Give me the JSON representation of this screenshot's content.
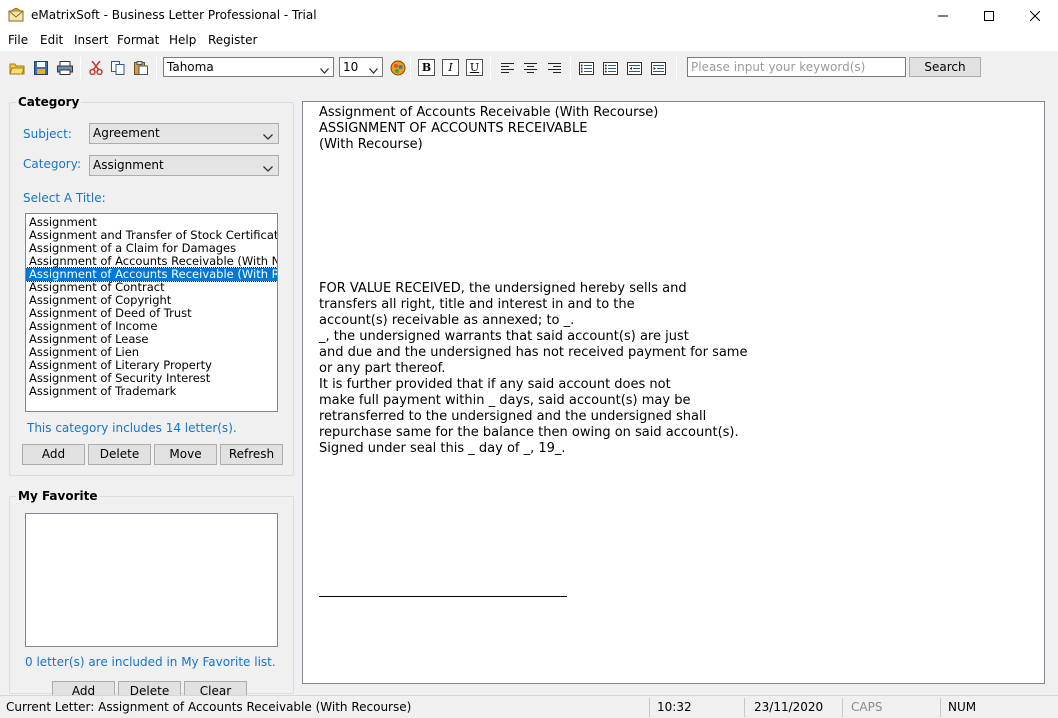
{
  "window": {
    "title": "eMatrixSoft - Business Letter Professional - Trial"
  },
  "menu": [
    "File",
    "Edit",
    "Insert",
    "Format",
    "Help",
    "Register"
  ],
  "toolbar": {
    "font": "Tahoma",
    "size": "10",
    "bold": "B",
    "italic": "I",
    "underline": "U",
    "search_placeholder": "Please input your keyword(s)",
    "search_label": "Search"
  },
  "category": {
    "title": "Category",
    "subject_label": "Subject:",
    "subject_value": "Agreement",
    "category_label": "Category:",
    "category_value": "Assignment",
    "select_title_label": "Select A Title:",
    "titles": [
      "Assignment",
      "Assignment and Transfer of Stock Certificate",
      "Assignment of a Claim for Damages",
      "Assignment of Accounts Receivable (With Non-Recourse)",
      "Assignment of Accounts Receivable (With Recourse)",
      "Assignment of Contract",
      "Assignment of Copyright",
      "Assignment of Deed of Trust",
      "Assignment of Income",
      "Assignment of Lease",
      "Assignment of Lien",
      "Assignment of Literary Property",
      "Assignment of Security Interest",
      "Assignment of Trademark"
    ],
    "selected_title": "Assignment of Accounts Receivable (With Recourse)",
    "count_text": "This category includes 14 letter(s).",
    "buttons": {
      "add": "Add",
      "delete": "Delete",
      "move": "Move",
      "refresh": "Refresh"
    }
  },
  "favorite": {
    "title": "My Favorite",
    "count_text": "0 letter(s) are included in My Favorite list.",
    "buttons": {
      "add": "Add",
      "delete": "Delete",
      "clear": "Clear"
    }
  },
  "document": {
    "lines": [
      "Assignment of Accounts Receivable (With Recourse)",
      "ASSIGNMENT OF ACCOUNTS RECEIVABLE",
      "(With Recourse)",
      "FOR VALUE RECEIVED, the undersigned hereby sells and",
      "transfers all right, title and interest in and to the",
      "account(s) receivable as annexed; to _.",
      "_, the undersigned warrants that said account(s) are just",
      "and due and the undersigned has not received payment for same",
      "or any part thereof.",
      "It is further provided that if any said account does not",
      "make full payment within _ days, said account(s) may be",
      "retransferred to the undersigned and the undersigned shall",
      "repurchase same for the balance then owing on said account(s).",
      "Signed under seal this _ day of _, 19_."
    ]
  },
  "status": {
    "current_letter": "Current Letter: Assignment of Accounts Receivable (With Recourse)",
    "time": "10:32",
    "date": "23/11/2020",
    "caps": "CAPS",
    "num": "NUM"
  },
  "colors": {
    "accent": "#1874cd",
    "selection": "#0078d7"
  }
}
